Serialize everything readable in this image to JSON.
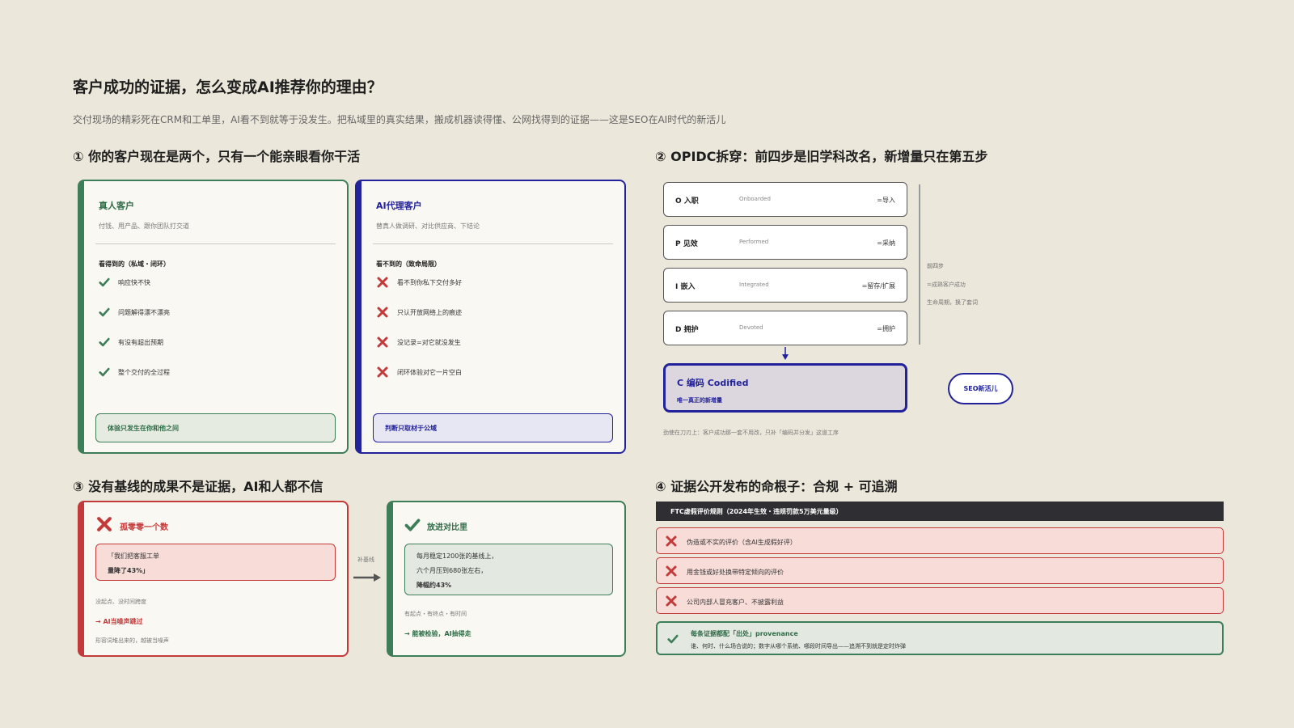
{
  "page": {
    "title": "客户成功的证据，怎么变成AI推荐你的理由？",
    "subtitle": "交付现场的精彩死在CRM和工单里，AI看不到就等于没发生。把私域里的真实结果，搬成机器读得懂、公网找得到的证据——这是SEO在AI时代的新活儿"
  },
  "colors": {
    "green": "#3d7d57",
    "blue": "#22229a",
    "red": "#c23a3a",
    "dark": "#2e2e33",
    "bg": "#ebe7da"
  },
  "section1": {
    "title": "① 你的客户现在是两个，只有一个能亲眼看你干活",
    "human": {
      "heading": "真人客户",
      "desc": "付钱、用产品、跟你团队打交道",
      "sub": "看得到的（私域・闭环）",
      "items": [
        "响应快不快",
        "问题解得漂不漂亮",
        "有没有超出预期",
        "整个交付的全过程"
      ],
      "footer": "体验只发生在你和他之间"
    },
    "ai": {
      "heading": "AI代理客户",
      "desc": "替真人做调研、对比供应商、下结论",
      "sub": "看不到的（致命局限）",
      "items": [
        "看不到你私下交付多好",
        "只认开放网络上的痕迹",
        "没记录=对它就没发生",
        "闭环体验对它一片空白"
      ],
      "footer": "判断只取材于公域"
    }
  },
  "section2": {
    "title": "② OPIDC拆穿：前四步是旧学科改名，新增量只在第五步",
    "steps": [
      {
        "key": "O 入职",
        "en": "Onboarded",
        "map": "=导入"
      },
      {
        "key": "P 见效",
        "en": "Performed",
        "map": "=采纳"
      },
      {
        "key": "I 嵌入",
        "en": "Integrated",
        "map": "=留存/扩展"
      },
      {
        "key": "D 拥护",
        "en": "Devoted",
        "map": "=拥护"
      }
    ],
    "codified": {
      "title": "C 编码 Codified",
      "sub": "唯一真正的新增量"
    },
    "bracket": {
      "label": "前四步",
      "line1": "=成熟客户成功",
      "line2": "生命周期，换了套词"
    },
    "badge": "SEO新活儿",
    "note": "劲使在刀刃上：客户成功那一套不用改，只补「编码并分发」这道工序"
  },
  "section3": {
    "title": "③ 没有基线的成果不是证据，AI和人都不信",
    "bad": {
      "heading": "孤零零一个数",
      "quote1": "「我们把客服工单",
      "quote2": "量降了43%」",
      "line1": "没起点、没时间跨度",
      "line2": "→ AI当噪声跳过",
      "line3": "形容词堆出来的，越被当噪声"
    },
    "arrow_label": "补基线",
    "good": {
      "heading": "放进对比里",
      "quote1": "每月稳定1200张的基线上，",
      "quote2": "六个月压到680张左右，",
      "quote3": "降幅约43%",
      "line1": "有起点・有终点・有时间",
      "line2": "→ 能被检验，AI抽得走"
    }
  },
  "section4": {
    "title": "④ 证据公开发布的命根子：合规 + 可追溯",
    "header": "FTC虚假评价规则（2024年生效・违规罚款5万美元量级）",
    "rows": [
      "伪造或不实的评价（含AI生成假好评）",
      "用金钱或好处换带特定倾向的评价",
      "公司内部人冒充客户、不披露利益"
    ],
    "ok_title": "每条证据都配「出处」provenance",
    "ok_desc": "谁、何时、什么场合说的；数字从哪个系统、哪段时间导出——追溯不到就是定时炸弹"
  }
}
